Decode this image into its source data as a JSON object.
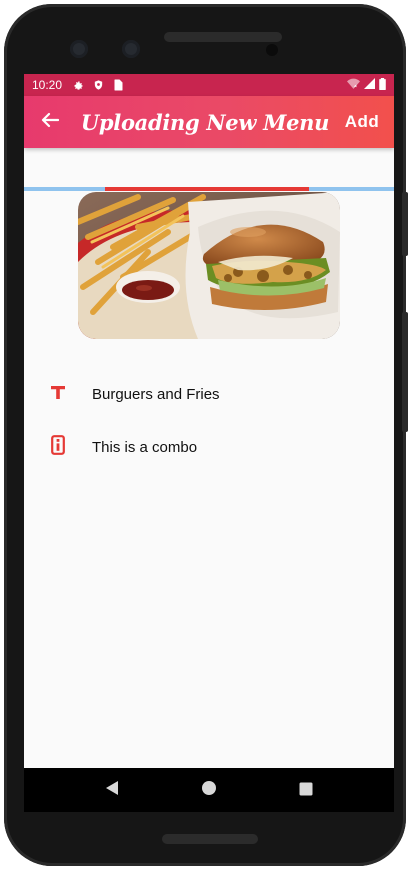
{
  "status_bar": {
    "time": "10:20",
    "left_icons": [
      "gear-icon",
      "shield-icon",
      "sim-card-icon"
    ],
    "right_icons": [
      "wifi-icon",
      "signal-icon",
      "battery-icon"
    ]
  },
  "app_bar": {
    "title": "Uploading New Menu",
    "back_icon": "arrow-left-icon",
    "action_label": "Add",
    "gradient": [
      "#e73a6d",
      "#f2504c"
    ]
  },
  "upload_progress": {
    "fraction": 0.55,
    "track_color": "#8fc3ee",
    "fill_color": "#e53935"
  },
  "menu_image": {
    "subject": "burger-and-fries"
  },
  "fields": [
    {
      "icon": "title-text-icon",
      "value": "Burguers and Fries"
    },
    {
      "icon": "info-icon",
      "value": "This is a combo"
    }
  ],
  "nav_bar": {
    "buttons": [
      "back-triangle-icon",
      "home-circle-icon",
      "recents-square-icon"
    ]
  },
  "colors": {
    "accent": "#e53935",
    "status_bar": "#c8254f",
    "background": "#fafafa"
  }
}
